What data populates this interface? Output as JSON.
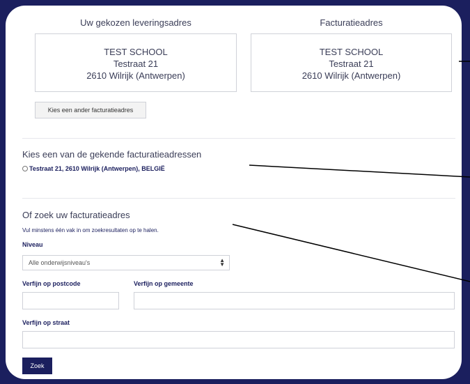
{
  "delivery": {
    "heading": "Uw gekozen leveringsadres",
    "name": "TEST SCHOOL",
    "street": "Testraat 21",
    "city": "2610 Wilrijk (Antwerpen)"
  },
  "invoice": {
    "heading": "Facturatieadres",
    "name": "TEST SCHOOL",
    "street": "Testraat 21",
    "city": "2610 Wilrijk (Antwerpen)",
    "change_button": "Kies een ander facturatieadres"
  },
  "known": {
    "title": "Kies een van de gekende facturatieadressen",
    "option": "Testraat 21, 2610 Wilrijk (Antwerpen), BELGIË"
  },
  "search": {
    "title": "Of zoek uw facturatieadres",
    "hint": "Vul minstens één vak in om zoekresultaten op te halen.",
    "level_label": "Niveau",
    "level_value": "Alle onderwijsniveau's",
    "postcode_label": "Verfijn op postcode",
    "municipality_label": "Verfijn op gemeente",
    "street_label": "Verfijn op straat",
    "submit": "Zoek"
  },
  "colors": {
    "frame": "#1b1f5e",
    "accent": "#1b1f5e"
  }
}
